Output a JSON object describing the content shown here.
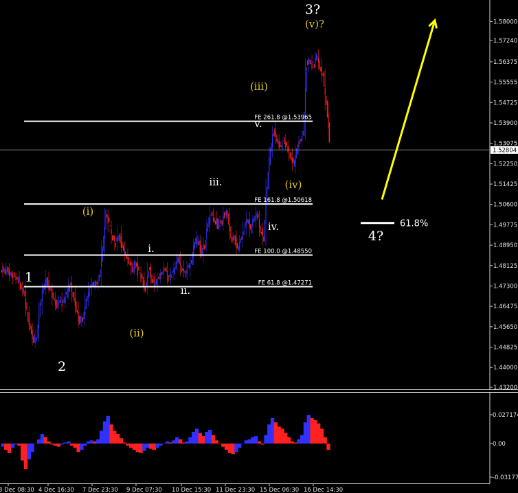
{
  "chart_data": [
    {
      "type": "candlestick",
      "price_axis": {
        "ylim": [
          1.432,
          1.5843
        ],
        "tick_labels": [
          "1.58000",
          "1.57240",
          "1.56375",
          "1.55555",
          "1.54725",
          "1.53900",
          "1.53075",
          "1.52250",
          "1.51425",
          "1.50600",
          "1.49775",
          "1.48950",
          "1.48125",
          "1.47300",
          "1.46475",
          "1.45650",
          "1.44825",
          "1.44000",
          "1.43200"
        ],
        "current_price_label": "1.52804",
        "current_price": 1.52804
      },
      "time_axis": {
        "tick_labels": [
          "3 Dec 08:30",
          "4 Dec 16:30",
          "7 Dec 23:30",
          "9 Dec 07:30",
          "10 Dec 15:30",
          "11 Dec 23:30",
          "15 Dec 06:30",
          "16 Dec 14:30"
        ]
      },
      "series": [
        {
          "close": [
            1.479,
            1.48,
            1.4775,
            1.477,
            1.476,
            1.473,
            1.471,
            1.463,
            1.456,
            1.451,
            1.453,
            1.465,
            1.472,
            1.476,
            1.472,
            1.468,
            1.465,
            1.467,
            1.466,
            1.47,
            1.474,
            1.47,
            1.464,
            1.458,
            1.46,
            1.468,
            1.472,
            1.474,
            1.474,
            1.476,
            1.488,
            1.502,
            1.498,
            1.492,
            1.49,
            1.494,
            1.488,
            1.486,
            1.483,
            1.48,
            1.482,
            1.478,
            1.476,
            1.472,
            1.48,
            1.476,
            1.474,
            1.476,
            1.478,
            1.48,
            1.476,
            1.478,
            1.481,
            1.484,
            1.48,
            1.478,
            1.48,
            1.483,
            1.49,
            1.492,
            1.486,
            1.49,
            1.498,
            1.502,
            1.5,
            1.498,
            1.498,
            1.502,
            1.502,
            1.493,
            1.492,
            1.488,
            1.492,
            1.496,
            1.5,
            1.496,
            1.5,
            1.502,
            1.496,
            1.492,
            1.514,
            1.528,
            1.536,
            1.532,
            1.53,
            1.531,
            1.53,
            1.526,
            1.522,
            1.528,
            1.532,
            1.534,
            1.562,
            1.564,
            1.562,
            1.566,
            1.562,
            1.558,
            1.546,
            1.533
          ]
        }
      ],
      "fibonacci_levels": [
        {
          "label": "FE 261.8 @1.53965",
          "price": 1.53965
        },
        {
          "label": "FE 161.8 @1.50618",
          "price": 1.50618
        },
        {
          "label": "FE 100.0 @1.48550",
          "price": 1.4855
        },
        {
          "label": "FE 61.8 @1.47271",
          "price": 1.47271
        }
      ],
      "target_marker": {
        "label": "61.8%",
        "price": 1.4985
      },
      "forecast_arrow": {
        "from_price": 1.508,
        "to_price": 1.5805,
        "color": "#ffff00"
      },
      "wave_labels_white": [
        "1",
        "2",
        "3?",
        "4?"
      ],
      "wave_labels_yellow": [
        "(i)",
        "(ii)",
        "(iii)",
        "(iv)",
        "(v)?"
      ],
      "wave_labels_small": [
        "i.",
        "ii.",
        "iii.",
        "iv.",
        "v."
      ],
      "colors": {
        "background": "#000000",
        "up": "#3030ff",
        "down": "#ff2020",
        "axis": "#e6e6e6",
        "arrow": "#ffff00",
        "label_yellow": "#e3c728"
      }
    },
    {
      "type": "histogram",
      "name": "oscillator",
      "ylim": [
        -0.03177,
        0.02717
      ],
      "tick_labels": [
        "0.027174",
        "0.00",
        "-0.03177"
      ],
      "values": [
        -0.003,
        -0.006,
        -0.009,
        -0.004,
        -0.001,
        -0.002,
        -0.016,
        -0.024,
        -0.015,
        -0.008,
        0.0,
        0.004,
        0.009,
        0.006,
        0.002,
        -0.001,
        -0.002,
        -0.003,
        -0.001,
        0.001,
        0.002,
        -0.002,
        -0.004,
        -0.008,
        -0.006,
        -0.002,
        0.002,
        0.003,
        0.002,
        0.004,
        0.012,
        0.021,
        0.026,
        0.018,
        0.012,
        0.009,
        0.005,
        0.001,
        -0.002,
        -0.004,
        -0.006,
        -0.008,
        -0.009,
        -0.007,
        -0.004,
        -0.005,
        -0.006,
        -0.004,
        -0.002,
        0.0,
        0.002,
        0.001,
        0.003,
        0.006,
        0.004,
        0.001,
        0.002,
        0.006,
        0.011,
        0.014,
        0.01,
        0.007,
        0.011,
        0.013,
        0.008,
        0.003,
        0.0,
        -0.003,
        -0.006,
        -0.009,
        -0.01,
        -0.008,
        -0.004,
        0.0,
        0.003,
        0.004,
        0.006,
        0.007,
        0.002,
        -0.001,
        0.008,
        0.018,
        0.024,
        0.02,
        0.016,
        0.014,
        0.01,
        0.006,
        0.002,
        0.001,
        0.004,
        0.008,
        0.02,
        0.027,
        0.024,
        0.022,
        0.019,
        0.014,
        0.006,
        -0.006
      ]
    }
  ]
}
